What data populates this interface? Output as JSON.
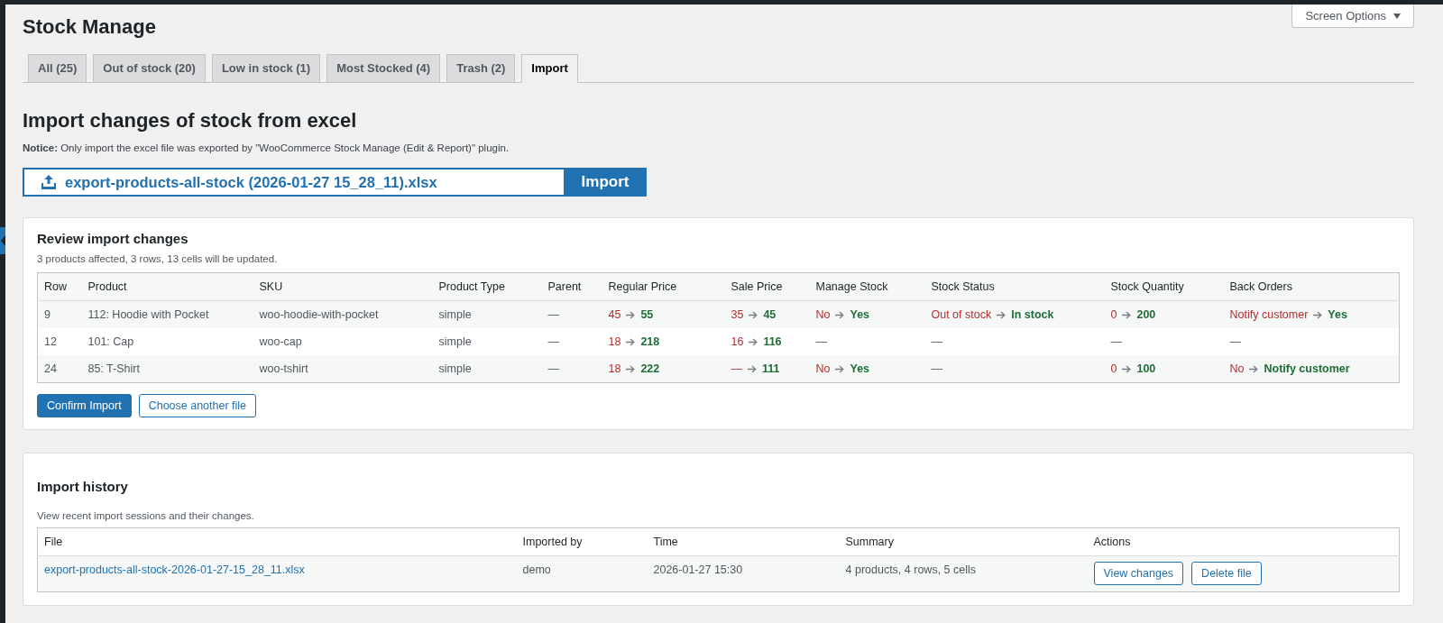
{
  "screen_options": {
    "label": "Screen Options"
  },
  "page_title": "Stock Manage",
  "tabs": [
    {
      "label": "All (25)",
      "selected": false
    },
    {
      "label": "Out of stock (20)",
      "selected": false
    },
    {
      "label": "Low in stock (1)",
      "selected": false
    },
    {
      "label": "Most Stocked (4)",
      "selected": false
    },
    {
      "label": "Trash (2)",
      "selected": false
    },
    {
      "label": "Import",
      "selected": true
    }
  ],
  "import_section": {
    "heading": "Import changes of stock from excel",
    "notice": "**Notice:** Only import the excel file was exported by \"WooCommerce Stock Manage (Edit & Report)\" plugin.",
    "file_name": "export-products-all-stock (2026-01-27 15_28_11).xlsx",
    "import_button": "Import"
  },
  "review": {
    "title": "Review import changes",
    "summary": "3 products affected, 3 rows, 13 cells will be updated.",
    "table": {
      "columns": [
        "Row",
        "Product",
        "SKU",
        "Product Type",
        "Parent",
        "Regular Price",
        "Sale Price",
        "Manage Stock",
        "Stock Status",
        "Stock Quantity",
        "Back Orders"
      ],
      "rows": [
        {
          "cells": [
            {
              "kind": "text",
              "text": "9"
            },
            {
              "kind": "text",
              "text": "112: Hoodie with Pocket"
            },
            {
              "kind": "text",
              "text": "woo-hoodie-with-pocket"
            },
            {
              "kind": "text",
              "text": "simple"
            },
            {
              "kind": "text",
              "text": "—"
            },
            {
              "kind": "change",
              "from": "45",
              "to": "55"
            },
            {
              "kind": "change",
              "from": "35",
              "to": "45"
            },
            {
              "kind": "change",
              "from": "No",
              "to": "Yes"
            },
            {
              "kind": "change",
              "from": "Out of stock",
              "to": "In stock"
            },
            {
              "kind": "change",
              "from": "0",
              "to": "200"
            },
            {
              "kind": "change",
              "from": "Notify customer",
              "to": "Yes"
            }
          ]
        },
        {
          "cells": [
            {
              "kind": "text",
              "text": "12"
            },
            {
              "kind": "text",
              "text": "101: Cap"
            },
            {
              "kind": "text",
              "text": "woo-cap"
            },
            {
              "kind": "text",
              "text": "simple"
            },
            {
              "kind": "text",
              "text": "—"
            },
            {
              "kind": "change",
              "from": "18",
              "to": "218"
            },
            {
              "kind": "change",
              "from": "16",
              "to": "116"
            },
            {
              "kind": "text",
              "text": "—"
            },
            {
              "kind": "text",
              "text": "—"
            },
            {
              "kind": "text",
              "text": "—"
            },
            {
              "kind": "text",
              "text": "—"
            }
          ]
        },
        {
          "cells": [
            {
              "kind": "text",
              "text": "24"
            },
            {
              "kind": "text",
              "text": "85: T-Shirt"
            },
            {
              "kind": "text",
              "text": "woo-tshirt"
            },
            {
              "kind": "text",
              "text": "simple"
            },
            {
              "kind": "text",
              "text": "—"
            },
            {
              "kind": "change",
              "from": "18",
              "to": "222"
            },
            {
              "kind": "change",
              "from": "—",
              "to": "111"
            },
            {
              "kind": "change",
              "from": "No",
              "to": "Yes"
            },
            {
              "kind": "text",
              "text": "—"
            },
            {
              "kind": "change",
              "from": "0",
              "to": "100"
            },
            {
              "kind": "change",
              "from": "No",
              "to": "Notify customer"
            }
          ]
        }
      ]
    },
    "buttons": [
      {
        "label": "Confirm Import",
        "kind": "primary"
      },
      {
        "label": "Choose another file",
        "kind": "secondary"
      }
    ]
  },
  "history": {
    "title": "Import history",
    "subtitle": "View recent import sessions and their changes.",
    "table": {
      "columns": [
        "File",
        "Imported by",
        "Time",
        "Summary",
        "Actions"
      ],
      "rows": [
        {
          "file": "export-products-all-stock-2026-01-27-15_28_11.xlsx",
          "imported_by": "demo",
          "time": "2026-01-27 15:30",
          "summary": "4 products, 4 rows, 5 cells",
          "actions": [
            "View changes",
            "Delete file"
          ]
        }
      ]
    }
  }
}
